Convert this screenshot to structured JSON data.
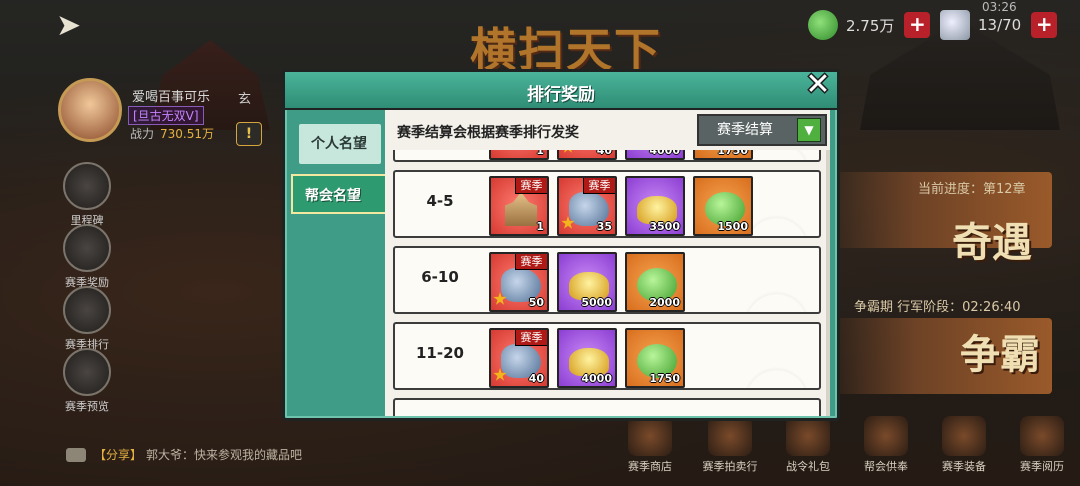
{
  "resources": {
    "jade_amount": "2.75万",
    "stamina": "13/70",
    "clock": "03:26"
  },
  "title_art": "横扫天下",
  "player": {
    "name": "爱喝百事可乐",
    "title": "[旦古无双V]",
    "power_label": "战力",
    "power": "730.51万",
    "alliance_prefix": "玄"
  },
  "left_menu": [
    {
      "label": "里程碑"
    },
    {
      "label": "赛季奖励"
    },
    {
      "label": "赛季排行"
    },
    {
      "label": "赛季预览"
    }
  ],
  "right": {
    "progress": "当前进度：第12章",
    "encounter": "奇遇",
    "phase": "争霸期 行军阶段：02:26:40",
    "dominate": "争霸"
  },
  "share": {
    "tag": "【分享】",
    "text": "郭大爷：快来参观我的藏品吧"
  },
  "bottom_menu": [
    {
      "label": "赛季商店"
    },
    {
      "label": "赛季拍卖行"
    },
    {
      "label": "战令礼包"
    },
    {
      "label": "帮会供奉"
    },
    {
      "label": "赛季装备"
    },
    {
      "label": "赛季阅历"
    }
  ],
  "modal": {
    "title": "排行奖励",
    "tabs": [
      "个人名望",
      "帮会名望"
    ],
    "description": "赛季结算会根据赛季排行发奖",
    "dropdown": "赛季结算",
    "season_badge": "赛季",
    "partial_row": {
      "items": [
        {
          "type": "red",
          "glyph": "castle",
          "qty": "1"
        },
        {
          "type": "red",
          "glyph": "dragon",
          "qty": "40"
        },
        {
          "type": "purple",
          "glyph": "ingot",
          "qty": "4000"
        },
        {
          "type": "orange",
          "glyph": "jade",
          "qty": "1750"
        }
      ]
    },
    "rows": [
      {
        "rank": "4-5",
        "items": [
          {
            "type": "red",
            "glyph": "castle",
            "qty": "1",
            "badge": true
          },
          {
            "type": "red",
            "glyph": "dragon",
            "qty": "35",
            "badge": true
          },
          {
            "type": "purple",
            "glyph": "ingot",
            "qty": "3500",
            "badge": false
          },
          {
            "type": "orange",
            "glyph": "jade",
            "qty": "1500",
            "badge": false
          }
        ]
      },
      {
        "rank": "6-10",
        "items": [
          {
            "type": "red",
            "glyph": "dragon",
            "qty": "50",
            "badge": true
          },
          {
            "type": "purple",
            "glyph": "ingot",
            "qty": "5000",
            "badge": false
          },
          {
            "type": "orange",
            "glyph": "jade",
            "qty": "2000",
            "badge": false
          }
        ]
      },
      {
        "rank": "11-20",
        "items": [
          {
            "type": "red",
            "glyph": "dragon",
            "qty": "40",
            "badge": true
          },
          {
            "type": "purple",
            "glyph": "ingot",
            "qty": "4000",
            "badge": false
          },
          {
            "type": "orange",
            "glyph": "jade",
            "qty": "1750",
            "badge": false
          }
        ]
      }
    ]
  }
}
